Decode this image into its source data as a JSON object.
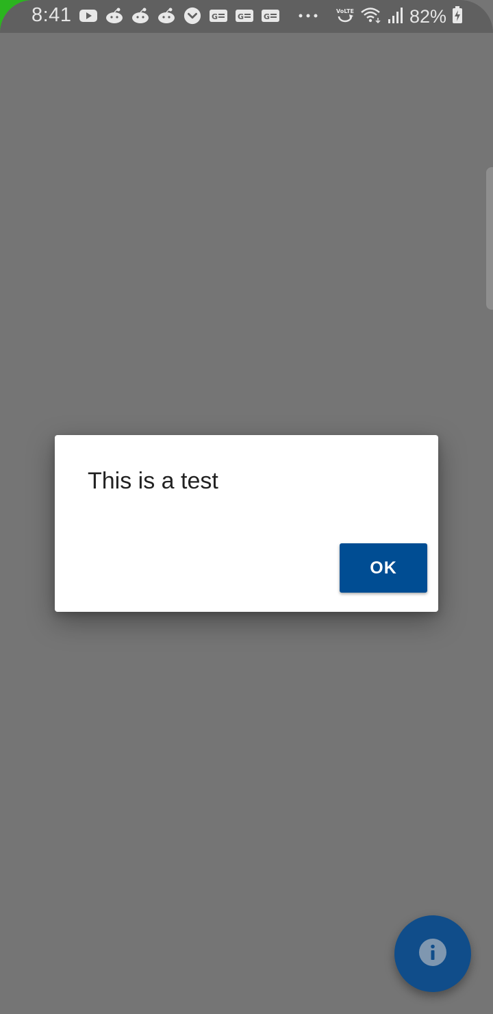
{
  "status_bar": {
    "time": "8:41",
    "battery": "82%",
    "notification_icons": [
      "youtube-icon",
      "reddit-icon",
      "reddit-icon",
      "reddit-icon",
      "pocket-icon",
      "news-icon",
      "news-icon",
      "news-icon",
      "more-dots-icon"
    ],
    "system_icons": [
      "volte-icon",
      "wifi-icon",
      "signal-icon",
      "battery-charging-icon"
    ]
  },
  "dialog": {
    "message": "This is a test",
    "ok_label": "OK"
  },
  "fab": {
    "icon": "info-icon"
  },
  "colors": {
    "scrim": "#757575",
    "status_bar": "#606060",
    "accent_edge": "#2bb51f",
    "ok_button": "#004d93",
    "fab": "#104d8a"
  }
}
